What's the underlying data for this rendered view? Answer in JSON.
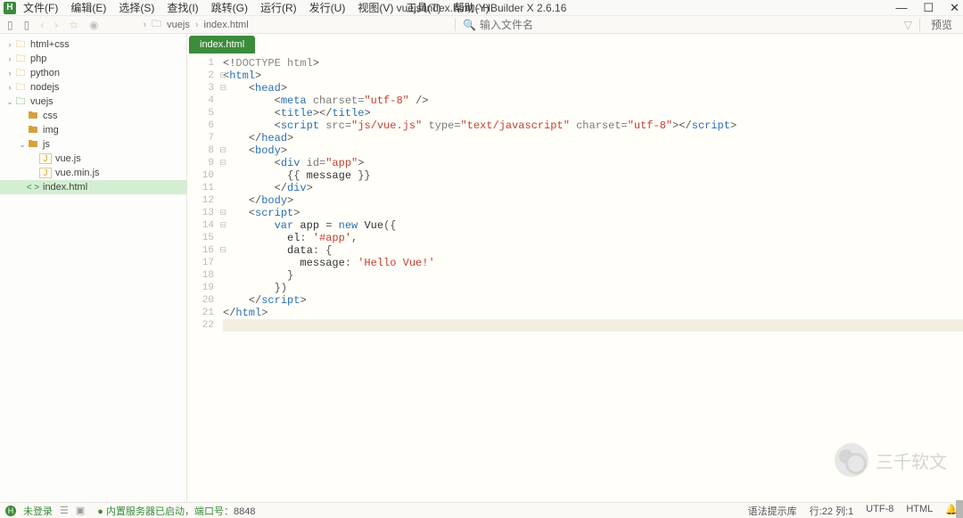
{
  "window": {
    "title": "vuejs/index.html - HBuilder X 2.6.16",
    "min": "—",
    "max": "☐",
    "close": "✕"
  },
  "menu": {
    "items": [
      "文件(F)",
      "编辑(E)",
      "选择(S)",
      "查找(I)",
      "跳转(G)",
      "运行(R)",
      "发行(U)",
      "视图(V)",
      "工具(T)",
      "帮助(Y)"
    ]
  },
  "toolbar": {
    "breadcrumb": {
      "a": "vuejs",
      "b": "index.html"
    },
    "search_placeholder": "输入文件名",
    "preview": "预览"
  },
  "tree": {
    "items": [
      {
        "pad": "pad-0",
        "arrow": "›",
        "ico": "folder-y",
        "glyph": "🗀",
        "label": "html+css",
        "interact": true
      },
      {
        "pad": "pad-0",
        "arrow": "›",
        "ico": "folder-y",
        "glyph": "🗀",
        "label": "php",
        "interact": true
      },
      {
        "pad": "pad-0",
        "arrow": "›",
        "ico": "folder-y",
        "glyph": "🗀",
        "label": "python",
        "interact": true
      },
      {
        "pad": "pad-0",
        "arrow": "›",
        "ico": "folder-y",
        "glyph": "🗀",
        "label": "nodejs",
        "interact": true
      },
      {
        "pad": "pad-0",
        "arrow": "⌄",
        "ico": "folder-g",
        "glyph": "🗀",
        "label": "vuejs",
        "interact": true
      },
      {
        "pad": "pad-1",
        "arrow": " ",
        "ico": "folder-y",
        "glyph": "🖿",
        "label": "css",
        "interact": true
      },
      {
        "pad": "pad-1",
        "arrow": " ",
        "ico": "folder-y",
        "glyph": "🖿",
        "label": "img",
        "interact": true
      },
      {
        "pad": "pad-1",
        "arrow": "⌄",
        "ico": "folder-y",
        "glyph": "🖿",
        "label": "js",
        "interact": true
      },
      {
        "pad": "pad-2",
        "arrow": " ",
        "ico": "file-js",
        "glyph": "J",
        "label": "vue.js",
        "interact": true
      },
      {
        "pad": "pad-2",
        "arrow": " ",
        "ico": "file-js",
        "glyph": "J",
        "label": "vue.min.js",
        "interact": true
      },
      {
        "pad": "pad-1",
        "arrow": " ",
        "ico": "file-html",
        "glyph": "< >",
        "label": "index.html",
        "interact": true,
        "active": true
      }
    ]
  },
  "tab": {
    "label": "index.html"
  },
  "code": {
    "lines": [
      {
        "n": 1,
        "html": "<span class='punc'>&lt;!</span><span class='doctype'>DOCTYPE html</span><span class='punc'>&gt;</span>"
      },
      {
        "n": 2,
        "html": "<span class='punc'>&lt;</span><span class='tag'>html</span><span class='punc'>&gt;</span>",
        "fold": true
      },
      {
        "n": 3,
        "html": "    <span class='punc'>&lt;</span><span class='tag'>head</span><span class='punc'>&gt;</span>",
        "fold": true
      },
      {
        "n": 4,
        "html": "        <span class='punc'>&lt;</span><span class='tag'>meta</span> <span class='attr'>charset=</span><span class='str'>\"utf-8\"</span> <span class='punc'>/&gt;</span>"
      },
      {
        "n": 5,
        "html": "        <span class='punc'>&lt;</span><span class='tag'>title</span><span class='punc'>&gt;&lt;/</span><span class='tag'>title</span><span class='punc'>&gt;</span>"
      },
      {
        "n": 6,
        "html": "        <span class='punc'>&lt;</span><span class='tag'>script</span> <span class='attr'>src=</span><span class='str'>\"js/vue.js\"</span> <span class='attr'>type=</span><span class='str'>\"text/javascript\"</span> <span class='attr'>charset=</span><span class='str'>\"utf-8\"</span><span class='punc'>&gt;&lt;/</span><span class='tag'>script</span><span class='punc'>&gt;</span>"
      },
      {
        "n": 7,
        "html": "    <span class='punc'>&lt;/</span><span class='tag'>head</span><span class='punc'>&gt;</span>"
      },
      {
        "n": 8,
        "html": "    <span class='punc'>&lt;</span><span class='tag'>body</span><span class='punc'>&gt;</span>",
        "fold": true
      },
      {
        "n": 9,
        "html": "        <span class='punc'>&lt;</span><span class='tag'>div</span> <span class='attr'>id=</span><span class='str'>\"app\"</span><span class='punc'>&gt;</span>",
        "fold": true
      },
      {
        "n": 10,
        "html": "          <span class='punc'>{{</span> message <span class='punc'>}}</span>"
      },
      {
        "n": 11,
        "html": "        <span class='punc'>&lt;/</span><span class='tag'>div</span><span class='punc'>&gt;</span>"
      },
      {
        "n": 12,
        "html": "    <span class='punc'>&lt;/</span><span class='tag'>body</span><span class='punc'>&gt;</span>"
      },
      {
        "n": 13,
        "html": "    <span class='punc'>&lt;</span><span class='tag'>script</span><span class='punc'>&gt;</span>",
        "fold": true
      },
      {
        "n": 14,
        "html": "        <span class='kw'>var</span> app <span class='punc'>=</span> <span class='kw'>new</span> Vue<span class='punc'>({</span>",
        "fold": true
      },
      {
        "n": 15,
        "html": "          el<span class='punc'>:</span> <span class='str'>'#app'</span><span class='punc'>,</span>"
      },
      {
        "n": 16,
        "html": "          data<span class='punc'>:</span> <span class='punc'>{</span>",
        "fold": true
      },
      {
        "n": 17,
        "html": "            message<span class='punc'>:</span> <span class='str'>'Hello Vue!'</span>"
      },
      {
        "n": 18,
        "html": "          <span class='punc'>}</span>"
      },
      {
        "n": 19,
        "html": "        <span class='punc'>})</span>"
      },
      {
        "n": 20,
        "html": "    <span class='punc'>&lt;/</span><span class='tag'>script</span><span class='punc'>&gt;</span>"
      },
      {
        "n": 21,
        "html": "<span class='punc'>&lt;/</span><span class='tag'>html</span><span class='punc'>&gt;</span>"
      },
      {
        "n": 22,
        "html": "",
        "current": true
      }
    ]
  },
  "status": {
    "login": "未登录",
    "server_msg": "内置服务器已启动，端口号：",
    "port": "8848",
    "syntax": "语法提示库",
    "pos": "行:22  列:1",
    "encoding": "UTF-8",
    "lang": "HTML",
    "bell": "🔔"
  },
  "watermark": {
    "text": "三千软文"
  }
}
